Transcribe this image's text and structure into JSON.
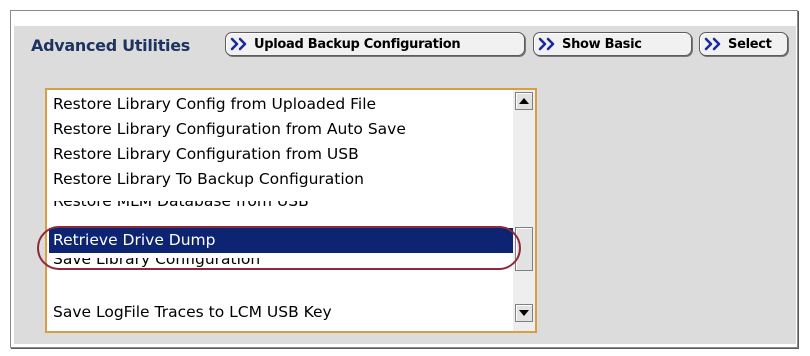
{
  "header": {
    "title": "Advanced Utilities"
  },
  "toolbar": {
    "buttons": [
      {
        "label": "Upload Backup Configuration",
        "icon": "double-chevron-right-icon"
      },
      {
        "label": "Show Basic",
        "icon": "double-chevron-right-icon"
      },
      {
        "label": "Select",
        "icon": "double-chevron-right-icon"
      }
    ]
  },
  "utilities_list": {
    "items": [
      {
        "label": "Restore Library Config from Uploaded File",
        "selected": false
      },
      {
        "label": "Restore Library Configuration from Auto Save",
        "selected": false
      },
      {
        "label": "Restore Library Configuration from USB",
        "selected": false
      },
      {
        "label": "Restore Library To Backup Configuration",
        "selected": false
      },
      {
        "label": "Restore MLM Database from USB",
        "selected": false
      },
      {
        "label": "Retrieve Drive Dump",
        "selected": true
      },
      {
        "label": "Save Library Configuration",
        "selected": false
      },
      {
        "label": "Save LogFile Traces to LCM USB Key",
        "selected": false
      }
    ],
    "scroll_up_icon": "triangle-up-icon",
    "scroll_down_icon": "triangle-down-icon"
  },
  "colors": {
    "header_text": "#1e3460",
    "button_arrow": "#1a2a9a",
    "list_border": "#d89e45",
    "selection_bg": "#0c2471",
    "highlight_ring": "#8c2a3a",
    "panel_bg": "#dcdcdc"
  }
}
